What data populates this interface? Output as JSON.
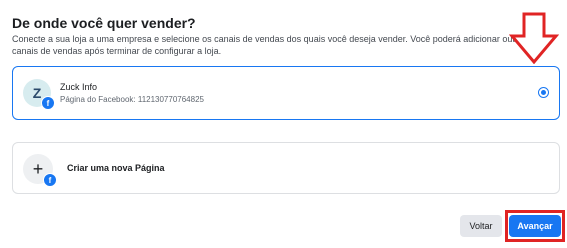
{
  "header": {
    "title": "De onde você quer vender?",
    "description": "Conecte a sua loja a uma empresa e selecione os canais de vendas dos quais você deseja vender. Você poderá adicionar outros canais de vendas após terminar de configurar a loja."
  },
  "options": [
    {
      "avatar_letter": "Z",
      "name": "Zuck Info",
      "subtitle": "Página do Facebook: 112130770764825",
      "selected": true
    },
    {
      "icon": "plus-icon",
      "label": "Criar uma nova Página",
      "selected": false
    }
  ],
  "badge": {
    "letter": "f"
  },
  "footer": {
    "back_label": "Voltar",
    "next_label": "Avançar"
  },
  "colors": {
    "accent": "#1877f2",
    "annotation": "#e02424"
  }
}
